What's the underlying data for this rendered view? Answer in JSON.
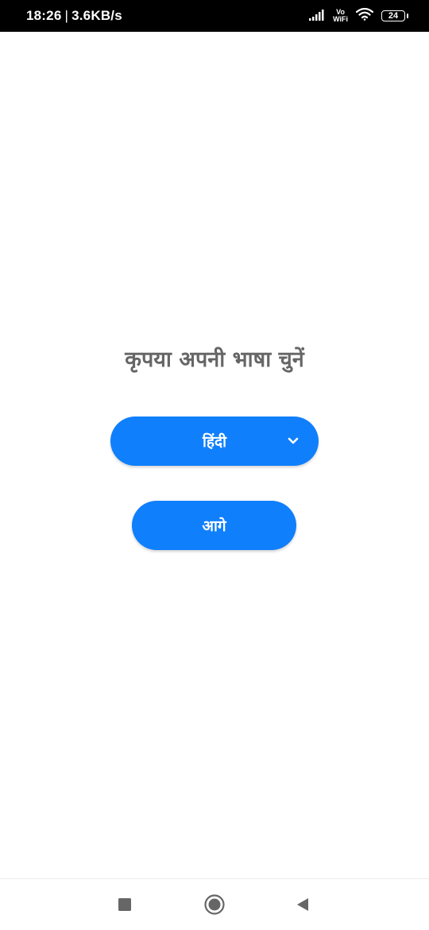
{
  "status_bar": {
    "time": "18:26",
    "separator": "|",
    "net_speed": "3.6KB/s",
    "volte_top": "Vo",
    "volte_bottom": "WiFi",
    "battery": "24",
    "icons": [
      "signal-icon",
      "vowifi-icon",
      "wifi-icon",
      "battery-icon"
    ]
  },
  "main": {
    "prompt": "कृपया अपनी भाषा चुनें",
    "language_selector": {
      "selected": "हिंदी",
      "icon": "chevron-down-icon"
    },
    "next_button": "आगे"
  },
  "colors": {
    "accent": "#0f7ffc",
    "prompt_text": "#666666",
    "nav_icon": "#666666"
  },
  "nav_bar": {
    "icons": [
      "recents-square-icon",
      "home-circle-icon",
      "back-triangle-icon"
    ]
  }
}
